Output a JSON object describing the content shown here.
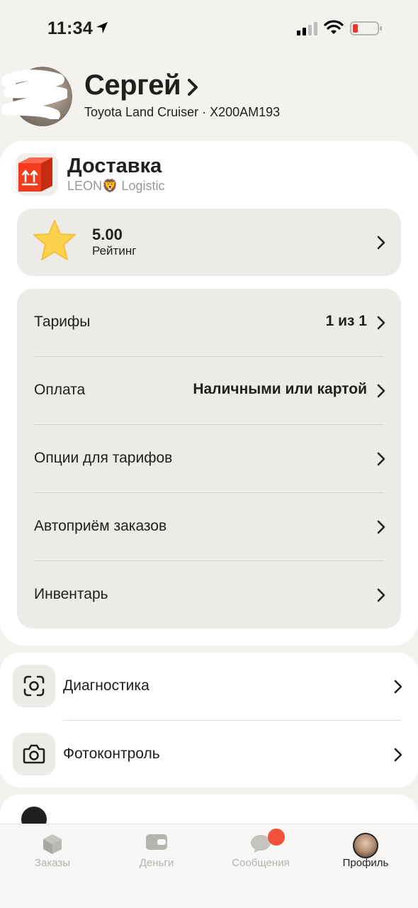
{
  "status_bar": {
    "time": "11:34"
  },
  "profile": {
    "name": "Сергей",
    "car": "Toyota Land Cruiser · Х200АМ193"
  },
  "business": {
    "title": "Доставка",
    "subtitle": "LEON🦁 Logistic"
  },
  "rating": {
    "value": "5.00",
    "label": "Рейтинг"
  },
  "settings": [
    {
      "label": "Тарифы",
      "value": "1 из 1"
    },
    {
      "label": "Оплата",
      "value": "Наличными или картой"
    },
    {
      "label": "Опции для тарифов",
      "value": ""
    },
    {
      "label": "Автоприём заказов",
      "value": ""
    },
    {
      "label": "Инвентарь",
      "value": ""
    }
  ],
  "tools": [
    {
      "label": "Диагностика",
      "icon": "scan-icon"
    },
    {
      "label": "Фотоконтроль",
      "icon": "camera-icon"
    }
  ],
  "tab_bar": {
    "tabs": [
      {
        "label": "Заказы",
        "icon": "orders-box-icon",
        "active": false
      },
      {
        "label": "Деньги",
        "icon": "wallet-icon",
        "active": false
      },
      {
        "label": "Сообщения",
        "icon": "chat-icon",
        "active": false,
        "badge": true
      },
      {
        "label": "Профиль",
        "icon": "avatar",
        "active": true
      }
    ]
  },
  "colors": {
    "accent_red": "#f0533a",
    "card_bg": "#ecebe8",
    "page_bg": "#f3f2ef"
  }
}
